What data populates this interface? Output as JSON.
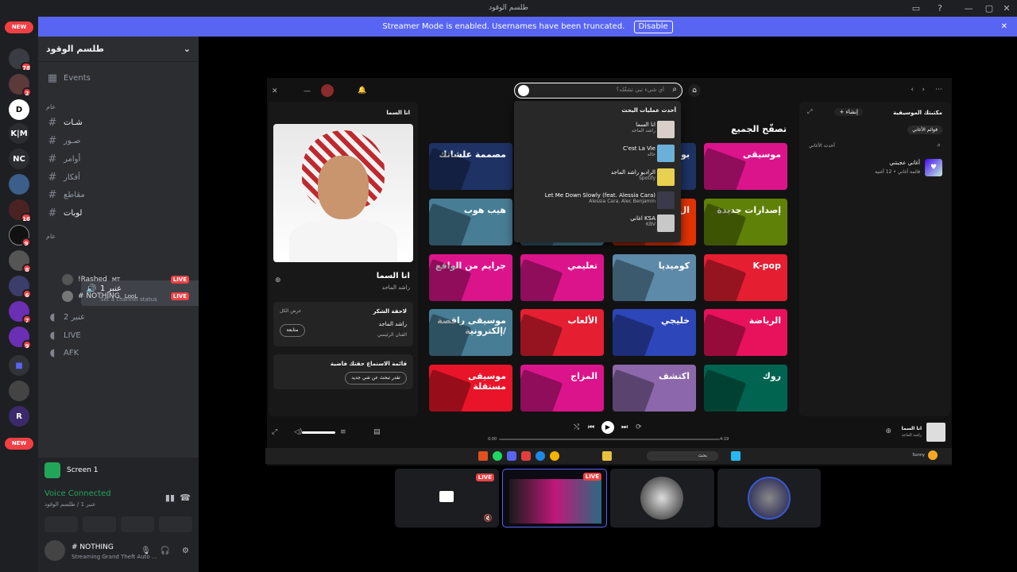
{
  "window": {
    "title": "طلسم الوقود"
  },
  "banner": {
    "text": "Streamer Mode is enabled. Usernames have been truncated.",
    "disable_label": "Disable"
  },
  "rail": {
    "new_label": "NEW",
    "servers": [
      {
        "label": "",
        "badge": "78"
      },
      {
        "label": "",
        "badge": "2"
      },
      {
        "label": "",
        "badge": ""
      },
      {
        "label": "K|M",
        "badge": ""
      },
      {
        "label": "NC",
        "badge": ""
      },
      {
        "label": "",
        "badge": ""
      },
      {
        "label": "",
        "badge": "16"
      },
      {
        "label": "",
        "badge": "9"
      },
      {
        "label": "",
        "badge": "8"
      },
      {
        "label": "",
        "badge": "6"
      },
      {
        "label": "",
        "badge": "7"
      },
      {
        "label": "",
        "badge": "9"
      }
    ]
  },
  "sidebar": {
    "server_name": "طلسم الوقود",
    "events_label": "Events",
    "category_text": "عام",
    "text_channels": [
      "شـات",
      "صـور",
      "أوامر",
      "أفكار",
      "مقاطع",
      "لوبات"
    ],
    "voice_category": "عام",
    "voice_channels": [
      {
        "name": "عنبر 1",
        "status": "Set a channel status"
      },
      {
        "name": "عنبر 2"
      },
      {
        "name": "LIVE"
      },
      {
        "name": "AFK"
      }
    ],
    "members": [
      {
        "name": "!Rashed",
        "tag": "MT",
        "live": "LIVE"
      },
      {
        "name": "# NOTHING",
        "tag": "LooL",
        "live": "LIVE"
      }
    ]
  },
  "user_panel": {
    "screen_label": "Screen 1",
    "voice_status": "Voice Connected",
    "voice_location": "عنبر 1 / طلسم الوقود",
    "username": "# NOTHING",
    "activity": "Streaming Grand Theft Auto ..."
  },
  "spotify": {
    "search_placeholder": "أي شيء تبي تشغّله؟",
    "now_playing": {
      "title": "انا السما",
      "artist": "راشد الماجد"
    },
    "panel_title": "انا السما",
    "credits_heading": "لاحقة الشكر",
    "credits_show_all": "عرض الكل",
    "credit_artist": "راشد الماجد",
    "credit_role": "الفنان الرئيسي",
    "follow_label": "متابعة",
    "queue_heading": "قائمة الاستماع حقتك فاضية",
    "queue_button": "تقدر تبحث عن شي جديد",
    "recent_searches_title": "أحدث عمليات البحث",
    "recent_searches": [
      {
        "title": "انا السما",
        "sub": "راشد الماجد"
      },
      {
        "title": "C'est La Vie",
        "sub": "خالد"
      },
      {
        "title": "الراديو راشد الماجد",
        "sub": "Spotify"
      },
      {
        "title": "Let Me Down Slowly (feat. Alessia Cara)",
        "sub": "Alessia Cara, Alec Benjamin"
      },
      {
        "title": "اغاني KSA",
        "sub": "KBV"
      }
    ],
    "browse_title": "تصفّح الجميع",
    "tiles": [
      {
        "label": "موسيقى",
        "color": "#dc148c"
      },
      {
        "label": "بو",
        "color": "#1e3264"
      },
      {
        "label": "",
        "color": "#e8115b"
      },
      {
        "label": "مصممة علشانك",
        "color": "#1e3264"
      },
      {
        "label": "إصدارات جديدة",
        "color": "#608108"
      },
      {
        "label": "ال",
        "color": "#e13300"
      },
      {
        "label": "",
        "color": "#477d95"
      },
      {
        "label": "هيب هوب",
        "color": "#477d95"
      },
      {
        "label": "K-pop",
        "color": "#e61e32"
      },
      {
        "label": "كوميديا",
        "color": "#5d8aa8"
      },
      {
        "label": "تعليمي",
        "color": "#dc148c"
      },
      {
        "label": "جرايم من الواقع",
        "color": "#dc148c"
      },
      {
        "label": "الرياضة",
        "color": "#e8115b"
      },
      {
        "label": "خليجي",
        "color": "#2d46b9"
      },
      {
        "label": "الألعاب",
        "color": "#e61e32"
      },
      {
        "label": "موسيقى راقصة /إلكترونية",
        "color": "#477d95"
      },
      {
        "label": "روك",
        "color": "#006450"
      },
      {
        "label": "اكتشف",
        "color": "#8d67ab"
      },
      {
        "label": "المزاج",
        "color": "#dc148c"
      },
      {
        "label": "موسيقى مستقلة",
        "color": "#e91429"
      }
    ],
    "library": {
      "title": "مكتبتك الموسيقية",
      "create_label": "إنشاء",
      "filter_label": "قوائم الأغاني",
      "sort_label": "أحدث الأغاني",
      "liked_title": "أغاني عجبتني",
      "liked_sub": "قائمة أغاني • 12 أغنية"
    },
    "player": {
      "elapsed": "0:00",
      "total": "4:19"
    }
  },
  "taskbar": {
    "search_text": "بحث",
    "weather": "Sunny"
  },
  "video_tiles": {
    "live_label": "LIVE"
  }
}
